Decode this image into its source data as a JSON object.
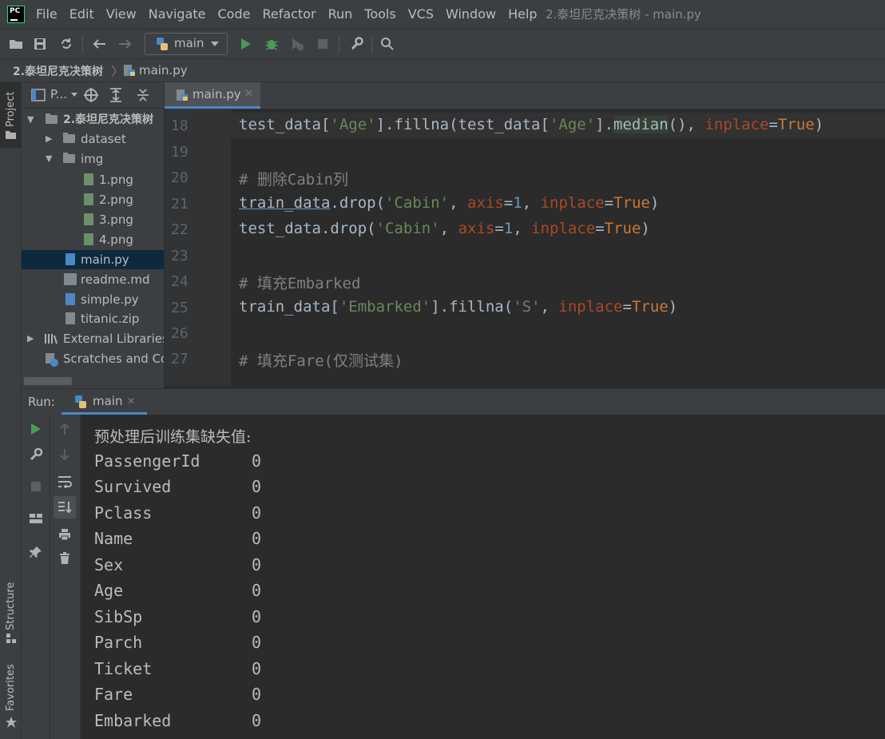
{
  "app": {
    "logo_text": "PC",
    "window_title": "2.泰坦尼克决策树 - main.py",
    "menu": [
      "File",
      "Edit",
      "View",
      "Navigate",
      "Code",
      "Refactor",
      "Run",
      "Tools",
      "VCS",
      "Window",
      "Help"
    ]
  },
  "toolbar": {
    "run_config": "main"
  },
  "breadcrumb": {
    "project": "2.泰坦尼克决策树",
    "file": "main.py"
  },
  "sidebar": {
    "project_tab": "Project",
    "structure_tab": "Structure",
    "favorites_tab": "Favorites"
  },
  "project_panel": {
    "header_label": "P...",
    "root": "2.泰坦尼克决策树",
    "items": [
      {
        "label": "dataset",
        "kind": "folder"
      },
      {
        "label": "img",
        "kind": "folder"
      },
      {
        "label": "1.png",
        "kind": "image"
      },
      {
        "label": "2.png",
        "kind": "image"
      },
      {
        "label": "3.png",
        "kind": "image"
      },
      {
        "label": "4.png",
        "kind": "image"
      },
      {
        "label": "main.py",
        "kind": "python"
      },
      {
        "label": "readme.md",
        "kind": "markdown"
      },
      {
        "label": "simple.py",
        "kind": "python"
      },
      {
        "label": "titanic.zip",
        "kind": "archive"
      },
      {
        "label": "External Libraries",
        "kind": "library"
      },
      {
        "label": "Scratches and Co",
        "kind": "scratch"
      }
    ]
  },
  "editor": {
    "tab": "main.py",
    "line_numbers": [
      "18",
      "19",
      "20",
      "21",
      "22",
      "23",
      "24",
      "25",
      "26",
      "27"
    ]
  },
  "run": {
    "label": "Run:",
    "tab": "main",
    "output_header": "预处理后训练集缺失值:",
    "output_rows": [
      {
        "name": "PassengerId",
        "value": "0"
      },
      {
        "name": "Survived",
        "value": "0"
      },
      {
        "name": "Pclass",
        "value": "0"
      },
      {
        "name": "Name",
        "value": "0"
      },
      {
        "name": "Sex",
        "value": "0"
      },
      {
        "name": "Age",
        "value": "0"
      },
      {
        "name": "SibSp",
        "value": "0"
      },
      {
        "name": "Parch",
        "value": "0"
      },
      {
        "name": "Ticket",
        "value": "0"
      },
      {
        "name": "Fare",
        "value": "0"
      },
      {
        "name": "Embarked",
        "value": "0"
      }
    ]
  },
  "colors": {
    "accent": "#4a88c7",
    "string": "#6a8759",
    "keyword": "#cc7832",
    "number": "#6897bb",
    "comment": "#808080"
  }
}
